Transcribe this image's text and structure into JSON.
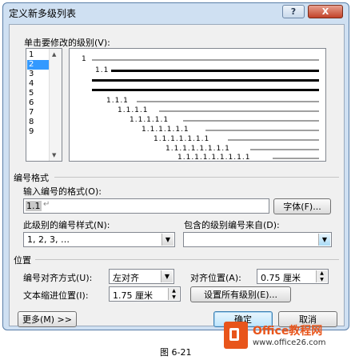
{
  "dialog": {
    "title": "定义新多级列表",
    "help_glyph": "?",
    "close_glyph": "X"
  },
  "level_select": {
    "label": "单击要修改的级别(V):",
    "levels": [
      "1",
      "2",
      "3",
      "4",
      "5",
      "6",
      "7",
      "8",
      "9"
    ],
    "selected": "2"
  },
  "preview": {
    "labels": [
      "1",
      "1.1",
      "1.1.1",
      "1.1.1.1",
      "1.1.1.1.1",
      "1.1.1.1.1.1",
      "1.1.1.1.1.1.1",
      "1.1.1.1.1.1.1.1",
      "1.1.1.1.1.1.1.1.1"
    ]
  },
  "number_format": {
    "section_label": "编号格式",
    "format_label": "输入编号的格式(O):",
    "format_value": "1.1",
    "font_button": "字体(F)...",
    "style_label": "此级别的编号样式(N):",
    "style_value": "1, 2, 3, …",
    "include_label": "包含的级别编号来自(D):",
    "include_value": ""
  },
  "position": {
    "section_label": "位置",
    "align_label": "编号对齐方式(U):",
    "align_value": "左对齐",
    "align_at_label": "对齐位置(A):",
    "align_at_value": "0.75 厘米",
    "indent_label": "文本缩进位置(I):",
    "indent_value": "1.75 厘米",
    "set_all_button": "设置所有级别(E)..."
  },
  "footer": {
    "more_button": "更多(M) >>",
    "ok_button": "确定",
    "cancel_button": "取消"
  },
  "watermark": {
    "brand": "Office教程网",
    "url": "www.office26.com"
  },
  "caption": "图 6-21"
}
